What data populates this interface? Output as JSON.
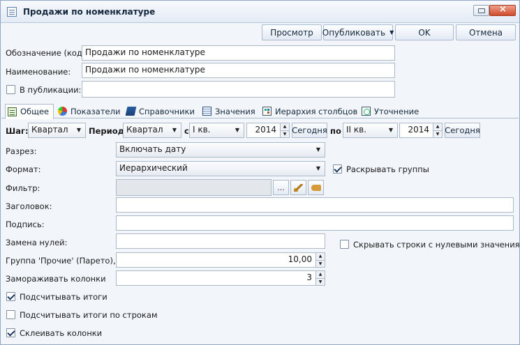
{
  "window": {
    "title": "Продажи по номенклатуре"
  },
  "toolbar": {
    "preview": "Просмотр",
    "publish": "Опубликовать",
    "ok": "OK",
    "cancel": "Отмена"
  },
  "header": {
    "code_label": "Обозначение (код):",
    "code_value": "Продажи по номенклатуре",
    "name_label": "Наименование:",
    "name_value": "Продажи по номенклатуре",
    "publication_label": "В публикации:",
    "publication_value": ""
  },
  "tabs": [
    {
      "label": "Общее",
      "icon": "document-icon",
      "active": true
    },
    {
      "label": "Показатели",
      "icon": "pie-chart-icon"
    },
    {
      "label": "Справочники",
      "icon": "book-icon"
    },
    {
      "label": "Значения",
      "icon": "table-icon"
    },
    {
      "label": "Иерархия столбцов",
      "icon": "hierarchy-icon"
    },
    {
      "label": "Уточнение",
      "icon": "filter-icon"
    }
  ],
  "period": {
    "step_label": "Шаг:",
    "step_value": "Квартал",
    "period_label": "Период:",
    "period_value": "Квартал",
    "from_label": "с",
    "from_quarter": "I кв.",
    "from_year": "2014",
    "today1": "Сегодня",
    "to_label": "по",
    "to_quarter": "II кв.",
    "to_year": "2014",
    "today2": "Сегодня"
  },
  "form": {
    "section_label": "Разрез:",
    "section_value": "Включать дату",
    "format_label": "Формат:",
    "format_value": "Иерархический",
    "expand_groups_label": "Раскрывать группы",
    "expand_groups_checked": true,
    "filter_label": "Фильтр:",
    "filter_value": "",
    "filter_browse": "...",
    "heading_label": "Заголовок:",
    "heading_value": "",
    "caption_label": "Подпись:",
    "caption_value": "",
    "zero_replace_label": "Замена нулей:",
    "zero_replace_value": "",
    "hide_zero_rows_label": "Скрывать строки с нулевыми значениями",
    "hide_zero_rows_checked": false,
    "other_group_label": "Группа 'Прочие' (Парето), %",
    "other_group_value": "10,00",
    "freeze_columns_label": "Замораживать колонки",
    "freeze_columns_value": "3",
    "calc_totals_label": "Подсчитывать итоги",
    "calc_totals_checked": true,
    "calc_row_totals_label": "Подсчитывать итоги по строкам",
    "calc_row_totals_checked": false,
    "merge_columns_label": "Склеивать колонки",
    "merge_columns_checked": true
  }
}
